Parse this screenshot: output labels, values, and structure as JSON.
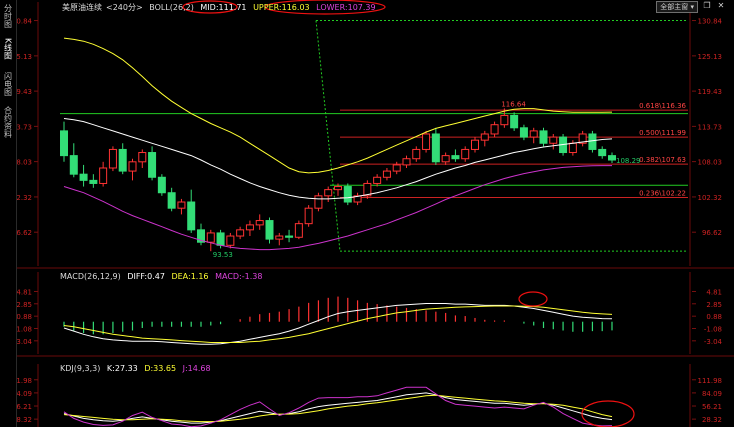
{
  "sidebar": {
    "items": [
      {
        "label": "分时图"
      },
      {
        "label": "K线图"
      },
      {
        "label": "闪电图"
      },
      {
        "label": "合约资料"
      }
    ]
  },
  "main_legend": {
    "instrument": "美原油连续",
    "period": "<240分>",
    "boll_label": "BOLL(26,2)",
    "mid": "MID:111.71",
    "upper": "UPPER:116.03",
    "lower": "LOWER:107.39"
  },
  "top_right": {
    "dropdown": "全部主窗",
    "restore_icon": "restore-icon",
    "close_icon": "close-icon"
  },
  "macd_legend": {
    "label": "MACD(26,12,9)",
    "diff": "DIFF:0.47",
    "dea": "DEA:1.16",
    "macd": "MACD:-1.38"
  },
  "kdj_legend": {
    "label": "KDJ(9,3,3)",
    "k": "K:27.33",
    "d": "D:33.65",
    "j": "J:14.68"
  },
  "colors": {
    "up": "#ff3333",
    "down": "#33dd77",
    "mid": "#ffffff",
    "upper": "#ffff33",
    "lower": "#cc33cc",
    "fib": "#cc2222",
    "support": "#22cc22",
    "axis_text": "#cc2222",
    "annotation": "#ee1111"
  },
  "chart_data": [
    {
      "type": "candlestick",
      "title": "美原油连续 <240分>",
      "yticks": [
        "130.84",
        "125.13",
        "119.43",
        "113.73",
        "108.03",
        "102.32",
        "96.62"
      ],
      "ylim": [
        91.8,
        131.9
      ],
      "bars": [
        {
          "o": 113.0,
          "h": 114.5,
          "l": 108.0,
          "c": 109.0
        },
        {
          "o": 109.0,
          "h": 111.0,
          "l": 105.5,
          "c": 106.0
        },
        {
          "o": 106.0,
          "h": 107.5,
          "l": 104.0,
          "c": 105.0
        },
        {
          "o": 105.0,
          "h": 106.0,
          "l": 103.8,
          "c": 104.5
        },
        {
          "o": 104.5,
          "h": 108.0,
          "l": 104.0,
          "c": 107.0
        },
        {
          "o": 107.0,
          "h": 110.5,
          "l": 106.5,
          "c": 110.0
        },
        {
          "o": 110.0,
          "h": 111.0,
          "l": 106.0,
          "c": 106.5
        },
        {
          "o": 106.5,
          "h": 108.5,
          "l": 105.0,
          "c": 108.0
        },
        {
          "o": 108.0,
          "h": 110.0,
          "l": 107.0,
          "c": 109.5
        },
        {
          "o": 109.5,
          "h": 110.5,
          "l": 105.0,
          "c": 105.5
        },
        {
          "o": 105.5,
          "h": 106.0,
          "l": 102.5,
          "c": 103.0
        },
        {
          "o": 103.0,
          "h": 103.8,
          "l": 100.0,
          "c": 100.5
        },
        {
          "o": 100.5,
          "h": 102.0,
          "l": 99.5,
          "c": 101.5
        },
        {
          "o": 101.5,
          "h": 103.5,
          "l": 96.5,
          "c": 97.0
        },
        {
          "o": 97.0,
          "h": 98.0,
          "l": 94.5,
          "c": 95.0
        },
        {
          "o": 95.0,
          "h": 97.0,
          "l": 93.55,
          "c": 96.5
        },
        {
          "o": 96.5,
          "h": 97.0,
          "l": 94.0,
          "c": 94.5
        },
        {
          "o": 94.5,
          "h": 96.5,
          "l": 94.0,
          "c": 96.0
        },
        {
          "o": 96.0,
          "h": 97.5,
          "l": 95.5,
          "c": 97.0
        },
        {
          "o": 97.0,
          "h": 98.5,
          "l": 96.0,
          "c": 97.8
        },
        {
          "o": 97.8,
          "h": 99.5,
          "l": 97.0,
          "c": 98.5
        },
        {
          "o": 98.5,
          "h": 99.0,
          "l": 94.8,
          "c": 95.5
        },
        {
          "o": 95.5,
          "h": 96.5,
          "l": 94.5,
          "c": 96.0
        },
        {
          "o": 96.0,
          "h": 97.0,
          "l": 95.0,
          "c": 95.8
        },
        {
          "o": 95.8,
          "h": 98.5,
          "l": 95.5,
          "c": 98.0
        },
        {
          "o": 98.0,
          "h": 101.0,
          "l": 97.5,
          "c": 100.5
        },
        {
          "o": 100.5,
          "h": 103.0,
          "l": 100.0,
          "c": 102.5
        },
        {
          "o": 102.5,
          "h": 104.0,
          "l": 101.5,
          "c": 103.5
        },
        {
          "o": 103.5,
          "h": 104.5,
          "l": 102.5,
          "c": 104.0
        },
        {
          "o": 104.0,
          "h": 104.5,
          "l": 101.0,
          "c": 101.5
        },
        {
          "o": 101.5,
          "h": 103.0,
          "l": 101.0,
          "c": 102.5
        },
        {
          "o": 102.5,
          "h": 105.0,
          "l": 102.0,
          "c": 104.5
        },
        {
          "o": 104.5,
          "h": 106.0,
          "l": 104.0,
          "c": 105.5
        },
        {
          "o": 105.5,
          "h": 107.0,
          "l": 105.0,
          "c": 106.5
        },
        {
          "o": 106.5,
          "h": 108.0,
          "l": 106.0,
          "c": 107.5
        },
        {
          "o": 107.5,
          "h": 109.0,
          "l": 107.0,
          "c": 108.5
        },
        {
          "o": 108.5,
          "h": 110.5,
          "l": 108.0,
          "c": 110.0
        },
        {
          "o": 110.0,
          "h": 113.0,
          "l": 109.5,
          "c": 112.5
        },
        {
          "o": 112.5,
          "h": 113.5,
          "l": 107.5,
          "c": 108.0
        },
        {
          "o": 108.0,
          "h": 109.5,
          "l": 107.5,
          "c": 109.0
        },
        {
          "o": 109.0,
          "h": 110.0,
          "l": 108.0,
          "c": 108.5
        },
        {
          "o": 108.5,
          "h": 110.5,
          "l": 108.0,
          "c": 110.0
        },
        {
          "o": 110.0,
          "h": 112.0,
          "l": 109.5,
          "c": 111.5
        },
        {
          "o": 111.5,
          "h": 113.0,
          "l": 110.5,
          "c": 112.5
        },
        {
          "o": 112.5,
          "h": 114.5,
          "l": 112.0,
          "c": 114.0
        },
        {
          "o": 114.0,
          "h": 116.64,
          "l": 113.5,
          "c": 115.5
        },
        {
          "o": 115.5,
          "h": 116.0,
          "l": 113.0,
          "c": 113.5
        },
        {
          "o": 113.5,
          "h": 114.0,
          "l": 111.5,
          "c": 112.0
        },
        {
          "o": 112.0,
          "h": 113.5,
          "l": 111.0,
          "c": 113.0
        },
        {
          "o": 113.0,
          "h": 113.5,
          "l": 110.5,
          "c": 111.0
        },
        {
          "o": 111.0,
          "h": 112.5,
          "l": 110.0,
          "c": 112.0
        },
        {
          "o": 112.0,
          "h": 112.5,
          "l": 109.0,
          "c": 109.5
        },
        {
          "o": 109.5,
          "h": 111.5,
          "l": 109.0,
          "c": 111.0
        },
        {
          "o": 111.0,
          "h": 113.0,
          "l": 110.5,
          "c": 112.5
        },
        {
          "o": 112.5,
          "h": 113.0,
          "l": 109.5,
          "c": 110.0
        },
        {
          "o": 110.0,
          "h": 110.5,
          "l": 108.5,
          "c": 109.0
        },
        {
          "o": 109.0,
          "h": 109.5,
          "l": 107.8,
          "c": 108.29
        }
      ],
      "series": [
        {
          "name": "MID",
          "values": [
            115,
            114.8,
            114.5,
            114,
            113.5,
            113,
            112.5,
            112,
            111.5,
            111,
            110.5,
            110,
            109.5,
            109,
            108.3,
            107.5,
            106.8,
            106,
            105.3,
            104.6,
            104,
            103.5,
            103,
            102.6,
            102.3,
            102.1,
            102,
            102,
            102.1,
            102.2,
            102.4,
            102.7,
            103,
            103.4,
            103.8,
            104.3,
            104.8,
            105.4,
            106,
            106.5,
            107,
            107.4,
            107.9,
            108.3,
            108.7,
            109.1,
            109.5,
            109.8,
            110.1,
            110.4,
            110.6,
            110.8,
            111,
            111.2,
            111.4,
            111.6,
            111.71
          ]
        },
        {
          "name": "UPPER",
          "values": [
            128,
            127.8,
            127.5,
            127,
            126.3,
            125.5,
            124.5,
            123.2,
            121.8,
            120.3,
            119,
            117.8,
            116.8,
            115.8,
            115,
            114.2,
            113.5,
            112.8,
            112,
            111,
            110,
            109,
            108,
            107,
            106.4,
            106.2,
            106.3,
            106.6,
            107,
            107.5,
            108,
            108.6,
            109.3,
            110,
            110.7,
            111.4,
            112.1,
            112.8,
            113.4,
            113.8,
            114.2,
            114.6,
            115,
            115.4,
            115.8,
            116.2,
            116.5,
            116.6,
            116.6,
            116.4,
            116.2,
            116.1,
            116,
            116,
            116,
            116,
            116.03
          ]
        },
        {
          "name": "LOWER",
          "values": [
            104,
            103.5,
            103,
            102.3,
            101.6,
            100.8,
            100,
            99.3,
            98.7,
            98.1,
            97.5,
            96.9,
            96.3,
            95.8,
            95.3,
            94.9,
            94.5,
            94.2,
            94,
            93.9,
            93.8,
            93.8,
            93.9,
            94,
            94.2,
            94.5,
            94.8,
            95.2,
            95.6,
            96,
            96.5,
            97,
            97.5,
            98,
            98.6,
            99.2,
            99.8,
            100.5,
            101.2,
            101.9,
            102.5,
            103.1,
            103.7,
            104.3,
            104.8,
            105.3,
            105.7,
            106.1,
            106.4,
            106.7,
            106.9,
            107.1,
            107.2,
            107.3,
            107.35,
            107.38,
            107.39
          ]
        }
      ],
      "fib_levels": [
        {
          "label": "0.618\\116.36",
          "value": 116.36
        },
        {
          "label": "0.500\\111.99",
          "value": 111.99
        },
        {
          "label": "0.382\\107.63",
          "value": 107.63
        },
        {
          "label": "0.236\\102.22",
          "value": 102.22
        }
      ],
      "horizontal_lines": [
        115.8,
        104.2
      ],
      "dotted_levels": [
        130.84,
        93.55
      ],
      "annotations": [
        {
          "text": "116.64",
          "value": 116.64
        },
        {
          "text": "93.53",
          "value": 93.55
        },
        {
          "text": "108.29",
          "value": 108.29
        }
      ]
    },
    {
      "type": "bar",
      "title": "MACD(26,12,9)",
      "yticks": [
        "4.81",
        "2.85",
        "0.88",
        "-1.08",
        "-3.04"
      ],
      "ylim": [
        -4.5,
        6.0
      ],
      "series": [
        {
          "name": "DIFF",
          "values": [
            -1,
            -1.5,
            -2,
            -2.4,
            -2.7,
            -2.9,
            -3,
            -3.1,
            -3.1,
            -3.1,
            -3.2,
            -3.3,
            -3.4,
            -3.5,
            -3.6,
            -3.6,
            -3.5,
            -3.3,
            -3.1,
            -2.8,
            -2.5,
            -2.2,
            -1.9,
            -1.5,
            -1,
            -0.4,
            0.2,
            0.8,
            1.3,
            1.6,
            1.8,
            2,
            2.2,
            2.4,
            2.6,
            2.7,
            2.8,
            2.9,
            2.9,
            2.9,
            2.8,
            2.8,
            2.7,
            2.6,
            2.6,
            2.6,
            2.5,
            2.3,
            2.1,
            1.8,
            1.5,
            1.2,
            0.9,
            0.7,
            0.6,
            0.5,
            0.47
          ]
        },
        {
          "name": "DEA",
          "values": [
            -0.6,
            -0.8,
            -1.1,
            -1.4,
            -1.7,
            -2,
            -2.2,
            -2.4,
            -2.6,
            -2.7,
            -2.8,
            -2.9,
            -3,
            -3.1,
            -3.2,
            -3.3,
            -3.3,
            -3.3,
            -3.3,
            -3.2,
            -3.1,
            -2.9,
            -2.7,
            -2.5,
            -2.2,
            -1.9,
            -1.5,
            -1.1,
            -0.7,
            -0.3,
            0.1,
            0.5,
            0.8,
            1.1,
            1.4,
            1.6,
            1.8,
            2,
            2.1,
            2.2,
            2.3,
            2.35,
            2.4,
            2.45,
            2.5,
            2.5,
            2.5,
            2.45,
            2.4,
            2.3,
            2.1,
            1.9,
            1.7,
            1.5,
            1.35,
            1.25,
            1.16
          ]
        }
      ],
      "values": [
        -0.8,
        -1.4,
        -1.8,
        -2,
        -2,
        -1.8,
        -1.6,
        -1.4,
        -1,
        -0.8,
        -0.8,
        -0.8,
        -0.8,
        -0.8,
        -0.8,
        -0.6,
        -0.4,
        0,
        0.4,
        0.8,
        1.2,
        1.4,
        1.6,
        2,
        2.4,
        3,
        3.4,
        3.8,
        4,
        3.8,
        3.4,
        3,
        2.8,
        2.6,
        2.4,
        2.2,
        2,
        1.8,
        1.6,
        1.4,
        1,
        0.9,
        0.6,
        0.3,
        0.2,
        0.2,
        0,
        -0.3,
        -0.6,
        -1,
        -1.2,
        -1.4,
        -1.6,
        -1.6,
        -1.5,
        -1.5,
        -1.38
      ]
    },
    {
      "type": "line",
      "title": "KDJ(9,3,3)",
      "yticks": [
        "111.98",
        "84.09",
        "56.21",
        "28.32"
      ],
      "ylim": [
        18,
        120
      ],
      "series": [
        {
          "name": "K",
          "values": [
            40,
            35,
            30,
            27,
            25,
            24,
            26,
            30,
            33,
            30,
            27,
            24,
            22,
            20,
            20,
            22,
            25,
            30,
            35,
            40,
            45,
            42,
            38,
            40,
            44,
            50,
            55,
            58,
            60,
            62,
            64,
            66,
            68,
            72,
            76,
            80,
            82,
            84,
            80,
            74,
            70,
            68,
            66,
            64,
            62,
            62,
            60,
            58,
            60,
            62,
            58,
            52,
            46,
            40,
            34,
            30,
            27.33
          ]
        },
        {
          "name": "D",
          "values": [
            38,
            36,
            34,
            32,
            30,
            28,
            27,
            27,
            28,
            29,
            28,
            27,
            25,
            24,
            23,
            23,
            24,
            26,
            28,
            31,
            35,
            38,
            39,
            39,
            40,
            43,
            46,
            50,
            53,
            56,
            58,
            61,
            63,
            66,
            69,
            72,
            75,
            78,
            79,
            77,
            75,
            73,
            71,
            69,
            67,
            66,
            64,
            62,
            61,
            61,
            60,
            58,
            54,
            50,
            44,
            38,
            33.65
          ]
        },
        {
          "name": "J",
          "values": [
            44,
            30,
            22,
            17,
            15,
            16,
            24,
            36,
            43,
            32,
            25,
            18,
            16,
            12,
            14,
            20,
            27,
            38,
            49,
            58,
            65,
            50,
            36,
            42,
            52,
            64,
            73,
            74,
            74,
            74,
            76,
            76,
            78,
            84,
            90,
            96,
            96,
            96,
            82,
            68,
            60,
            58,
            56,
            54,
            52,
            54,
            52,
            50,
            58,
            64,
            54,
            40,
            30,
            20,
            16,
            14,
            14.68
          ]
        }
      ]
    }
  ]
}
